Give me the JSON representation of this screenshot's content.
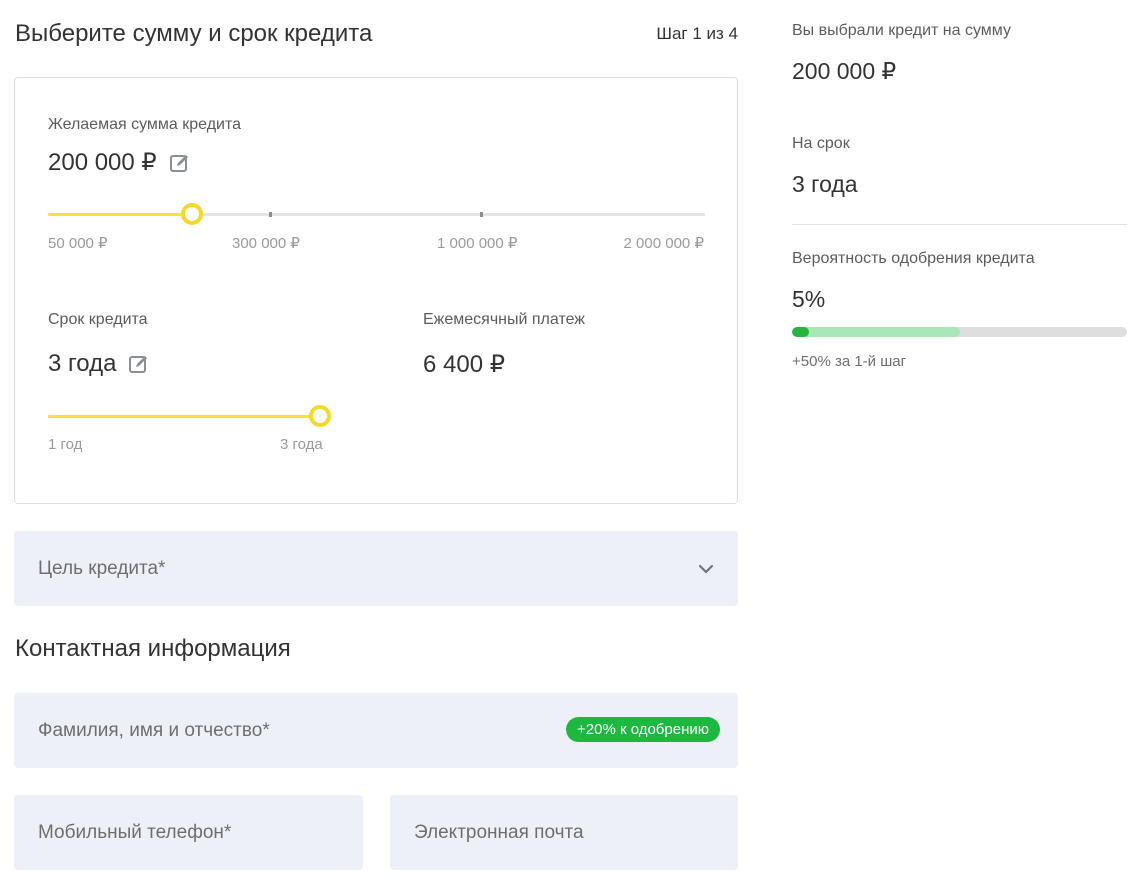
{
  "header": {
    "title": "Выберите сумму и срок кредита",
    "step": "Шаг 1 из 4"
  },
  "amount": {
    "label": "Желаемая сумма кредита",
    "value": "200 000 ₽",
    "slider_fraction": 0.21,
    "ticks": [
      "50 000 ₽",
      "300 000 ₽",
      "1 000 000 ₽",
      "2 000 000 ₽"
    ]
  },
  "term": {
    "label": "Срок кредита",
    "value": "3 года",
    "slider_fraction": 1.0,
    "ticks": [
      "1 год",
      "3 года"
    ]
  },
  "payment": {
    "label": "Ежемесячный платеж",
    "value": "6 400 ₽"
  },
  "purpose": {
    "placeholder": "Цель кредита*"
  },
  "contact": {
    "title": "Контактная информация",
    "fullname_placeholder": "Фамилия, имя и отчество*",
    "fullname_badge": "+20% к одобрению",
    "phone_placeholder": "Мобильный телефон*",
    "email_placeholder": "Электронная почта"
  },
  "summary": {
    "amount_label": "Вы выбрали кредит на сумму",
    "amount_value": "200 000 ₽",
    "term_label": "На срок",
    "term_value": "3 года",
    "approval_label": "Вероятность одобрения кредита",
    "approval_value": "5%",
    "approval_fraction": 0.05,
    "approval_potential_fraction": 0.5,
    "approval_hint": "+50% за 1-й шаг"
  },
  "colors": {
    "slider_fill": "#f6e044",
    "slider_thumb": "#f6d827",
    "field_bg": "#edf1f7",
    "badge_green": "#1db83f",
    "progress_green": "#25b53e",
    "progress_light_green": "#a9e8b6"
  },
  "icons": {
    "edit": "pencil-square-icon",
    "dropdown": "chevron-down-icon"
  }
}
